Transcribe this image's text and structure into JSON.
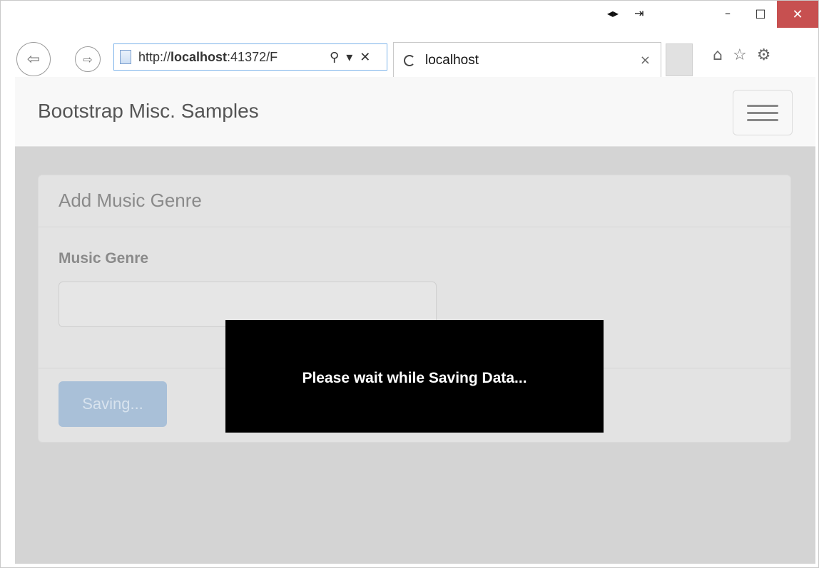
{
  "browser": {
    "title_icons": [
      "restore-split-icon",
      "reading-view-icon"
    ],
    "caption": {
      "minimize": "–",
      "maximize": "□",
      "close": "✕"
    },
    "address": {
      "url_prefix": "http://",
      "url_host": "localhost",
      "url_rest": ":41372/F"
    },
    "tab": {
      "title": "localhost",
      "close": "×"
    }
  },
  "page": {
    "brand": "Bootstrap Misc. Samples",
    "panel": {
      "heading": "Add Music Genre",
      "field_label": "Music Genre",
      "field_value": "",
      "button_label": "Saving..."
    },
    "overlay_message": "Please wait while Saving Data..."
  },
  "colors": {
    "close_button": "#c75050",
    "viewport_bg": "#d4d4d4",
    "saving_button": "#a9c0d8",
    "overlay_bg": "#000000"
  }
}
